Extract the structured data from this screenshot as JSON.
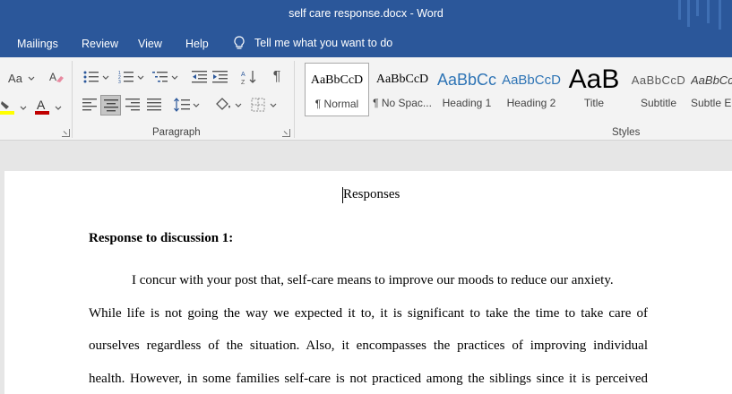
{
  "window": {
    "title": "self care response.docx  -  Word"
  },
  "menu": {
    "items": [
      "Mailings",
      "Review",
      "View",
      "Help"
    ],
    "tell_me": "Tell me what you want to do"
  },
  "ribbon": {
    "font_size_button": "Aa",
    "paragraph_group_label": "Paragraph",
    "styles_group_label": "Styles",
    "styles": [
      {
        "sample": "AaBbCcD",
        "name": "¶ Normal"
      },
      {
        "sample": "AaBbCcD",
        "name": "¶ No Spac..."
      },
      {
        "sample": "AaBbCc",
        "name": "Heading 1"
      },
      {
        "sample": "AaBbCcD",
        "name": "Heading 2"
      },
      {
        "sample": "AaB",
        "name": "Title"
      },
      {
        "sample": "AaBbCcD",
        "name": "Subtitle"
      },
      {
        "sample": "AaBbCcD",
        "name": "Subtle E"
      }
    ],
    "colors": {
      "highlight": "#ffff00",
      "font_color": "#c00000"
    }
  },
  "document": {
    "title": "Responses",
    "heading": "Response to discussion 1:",
    "lines": [
      "I concur with your post that, self-care means to improve our moods to reduce our anxiety.",
      "While life is not going the way we expected it to, it is significant to take the time to take care of",
      "ourselves regardless of the situation. Also, it encompasses the practices of improving individual",
      "health. However, in some families self-care is not practiced among the siblings since it is perceived"
    ]
  },
  "colors": {
    "brand": "#2b579a",
    "ribbon_bg": "#f3f3f3",
    "canvas_bg": "#e6e6e6"
  }
}
